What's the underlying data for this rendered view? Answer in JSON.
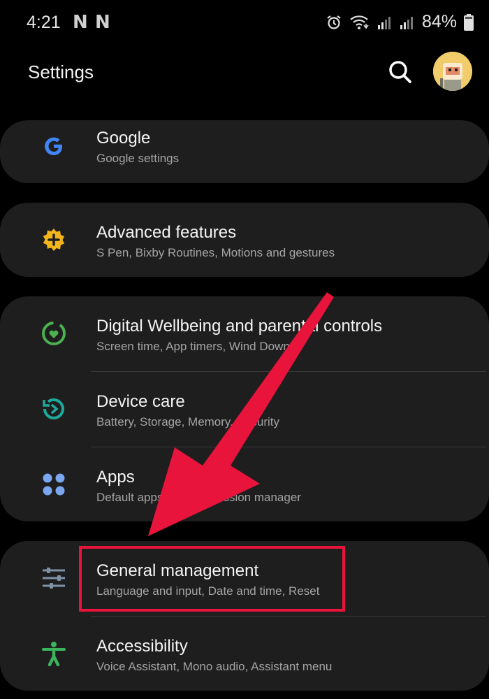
{
  "status_bar": {
    "time": "4:21",
    "notif_1": "N",
    "notif_2": "N",
    "battery_pct": "84%"
  },
  "header": {
    "title": "Settings"
  },
  "items": [
    {
      "title": "Google",
      "subtitle": "Google settings",
      "icon": "google-icon",
      "color": "#4285f4"
    },
    {
      "title": "Advanced features",
      "subtitle": "S Pen, Bixby Routines, Motions and gestures",
      "icon": "gear-plus-icon",
      "color": "#f4b51c"
    },
    {
      "title": "Digital Wellbeing and parental controls",
      "subtitle": "Screen time, App timers, Wind Down",
      "icon": "wellbeing-icon",
      "color": "#4caf50"
    },
    {
      "title": "Device care",
      "subtitle": "Battery, Storage, Memory, Security",
      "icon": "device-care-icon",
      "color": "#1fa99a"
    },
    {
      "title": "Apps",
      "subtitle": "Default apps, App permission manager",
      "icon": "apps-grid-icon",
      "color": "#7ba7f0"
    },
    {
      "title": "General management",
      "subtitle": "Language and input, Date and time, Reset",
      "icon": "sliders-icon",
      "color": "#7f93a8"
    },
    {
      "title": "Accessibility",
      "subtitle": "Voice Assistant, Mono audio, Assistant menu",
      "icon": "accessibility-icon",
      "color": "#3bb45c"
    }
  ],
  "colors": {
    "background": "#000000",
    "card": "#1e1e1e",
    "annotation": "#e8143c"
  }
}
